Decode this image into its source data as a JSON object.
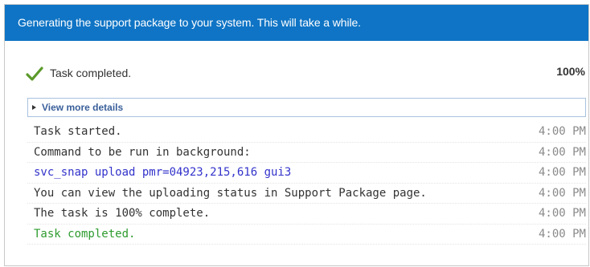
{
  "header": {
    "title": "Generating the support package to your system. This will take a while."
  },
  "status": {
    "icon": "check-icon",
    "text": "Task completed.",
    "percent": "100%",
    "progress_fraction": 1.0
  },
  "details": {
    "label": "View more details",
    "icon": "triangle-right-icon"
  },
  "log": [
    {
      "message": "Task started.",
      "time": "4:00 PM",
      "kind": "normal"
    },
    {
      "message": "Command to be run in background:",
      "time": "4:00 PM",
      "kind": "normal"
    },
    {
      "message": "svc_snap upload pmr=04923,215,616 gui3",
      "time": "4:00 PM",
      "kind": "command"
    },
    {
      "message": "You can view the uploading status in Support Package page.",
      "time": "4:00 PM",
      "kind": "normal"
    },
    {
      "message": "The task is 100% complete.",
      "time": "4:00 PM",
      "kind": "normal"
    },
    {
      "message": "Task completed.",
      "time": "4:00 PM",
      "kind": "success"
    }
  ],
  "colors": {
    "header_bg": "#0f74c5",
    "check": "#5b9a2a",
    "command_text": "#3333cc",
    "success_text": "#2e9b2e"
  }
}
